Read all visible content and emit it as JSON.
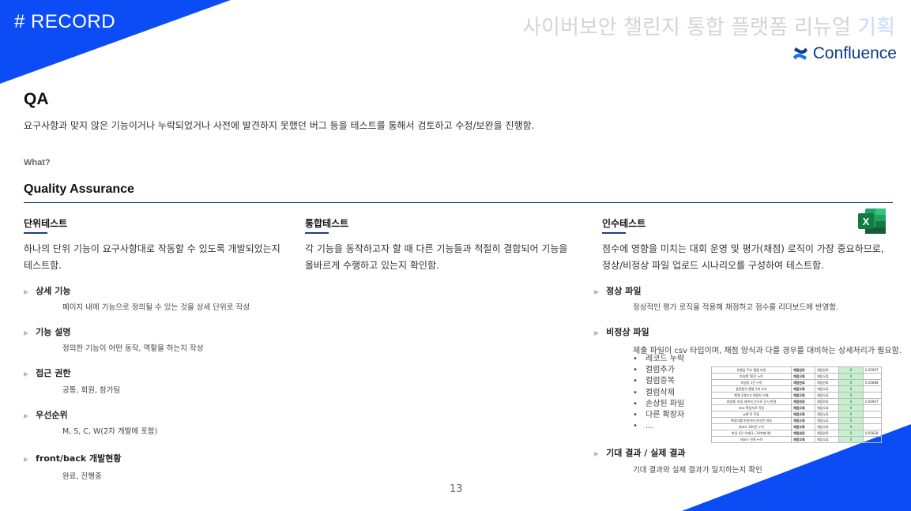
{
  "header": {
    "record": "# RECORD",
    "title_main": "사이버보안 챌린지 통합 플랫폼 리뉴얼 ",
    "title_highlight": "기획",
    "brand": "Confluence",
    "brand_icon": "confluence-icon",
    "colors": {
      "accent": "#0b4cf5",
      "brand": "#0a3b8f"
    }
  },
  "intro": {
    "heading": "QA",
    "description": "요구사항과 맞지 않은 기능이거나 누락되었거나 사전에 발견하지 못했던 버그 등을 테스트를 통해서 검토하고 수정/보완을 진행함.",
    "what_label": "What?",
    "full_name": "Quality Assurance"
  },
  "unit_test": {
    "title": "단위테스트",
    "desc_1": "하나의 단위 기능이 요구사항대로 작동할 수 있도록 개발되었는지",
    "desc_2": "테스트함.",
    "items": [
      {
        "label": "상세 기능",
        "sub": "페이지 내에 기능으로 정의될 수 있는 것을 상세 단위로 작성"
      },
      {
        "label": "기능 설명",
        "sub": "정의한 기능이 어떤 동작, 역할을 하는지 작성"
      },
      {
        "label": "접근 권한",
        "sub": "공통, 회원, 참가팀"
      },
      {
        "label": "우선순위",
        "sub": "M, S, C, W(2차 개발에 포함)"
      },
      {
        "label": "front/back 개발현황",
        "sub": "완료, 진행중"
      }
    ]
  },
  "integration_test": {
    "title": "통합테스트",
    "desc_1": "각 기능을 동작하고자 할 때 다른 기능들과 적절히 결합되어 기능을",
    "desc_2": "올바르게 수행하고 있는지 확인함."
  },
  "acceptance_test": {
    "title": "인수테스트",
    "icon": "excel-icon",
    "desc_1": "점수에 영향을 미치는 대회 운영 및 평가(채점) 로직이 가장 중요하므로,",
    "desc_2": "정상/비정상 파일 업로드 시나리오를 구성하여 테스트함.",
    "normal": {
      "label": "정상 파일",
      "sub": "정상적인 평가 로직을 적용해 채점하고 점수를 리더보드에 반영함."
    },
    "abnormal": {
      "label": "비정상 파일",
      "sub": "제출 파일이 csv 타입이며, 채점 양식과 다를 경우를 대비하는 상세처리가 필요함.",
      "bullets": [
        "레코드 누락",
        "컬럼추가",
        "컬럼중복",
        "컬럼삭제",
        "손상된 파일",
        "다른 확장자",
        "..."
      ]
    },
    "expected": {
      "label": "기대 결과 / 실제 결과",
      "sub": "기대 결과와 실제 결과가 일치하는지 확인"
    },
    "sheet_rows": [
      [
        "현행값 주요 행을 파일",
        "채점완료",
        "채점완료",
        "0",
        "0.05907"
      ],
      [
        "파일행 50건 누락",
        "채점오류",
        "채점오류",
        "0",
        ""
      ],
      [
        "파일의 1건 누락",
        "채점완료",
        "채점완료",
        "0",
        "0.05888"
      ],
      [
        "플랫폼의 행렬 1개 추가",
        "채점오류",
        "채점오류",
        "0",
        ""
      ],
      [
        "행렬 2개추가 채점차 삭제",
        "채점오류",
        "채점오류",
        "0",
        ""
      ],
      [
        "파일행, 파일 제목의 순으로 순서 변경",
        "채점완료",
        "채점완료",
        "0",
        "0.05907"
      ],
      [
        "xlsx 확장자로 작동",
        "채점오류",
        "채점오류",
        "0",
        ""
      ],
      [
        "pdf 로 작동",
        "채점오류",
        "채점오류",
        "0",
        ""
      ],
      [
        "확장자를 변경하여 손상된 파일",
        "채점오류",
        "채점오류",
        "0",
        ""
      ],
      [
        "레코드 100건 누락",
        "채점오류",
        "채점오류",
        "0",
        ""
      ],
      [
        "파일 4건 삭제(1~10번째 열)",
        "채점완료",
        "채점완료",
        "0",
        "0.05838"
      ],
      [
        "레코드 전체 누락",
        "채점오류",
        "채점오류",
        "0",
        ""
      ]
    ]
  },
  "page_number": "13"
}
